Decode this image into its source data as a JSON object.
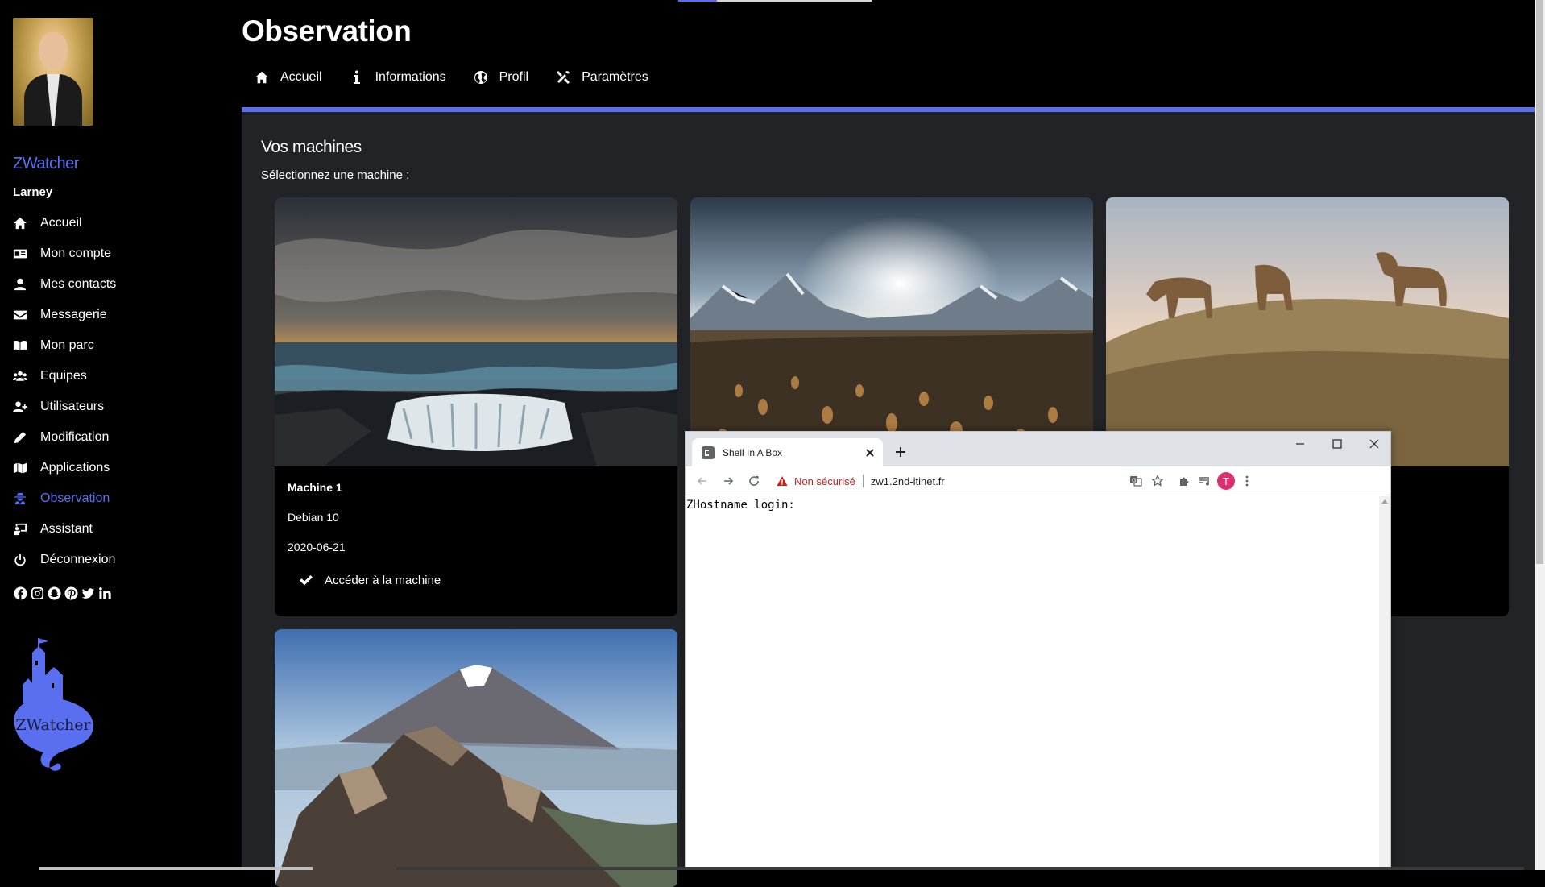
{
  "sidebar": {
    "brand": "ZWatcher",
    "username": "Larney",
    "items": [
      {
        "label": "Accueil",
        "icon": "home-icon"
      },
      {
        "label": "Mon compte",
        "icon": "id-card-icon"
      },
      {
        "label": "Mes contacts",
        "icon": "user-icon"
      },
      {
        "label": "Messagerie",
        "icon": "envelope-icon"
      },
      {
        "label": "Mon parc",
        "icon": "book-icon"
      },
      {
        "label": "Equipes",
        "icon": "users-icon"
      },
      {
        "label": "Utilisateurs",
        "icon": "user-plus-icon"
      },
      {
        "label": "Modification",
        "icon": "pencil-icon"
      },
      {
        "label": "Applications",
        "icon": "map-icon"
      },
      {
        "label": "Observation",
        "icon": "user-secret-icon",
        "active": true
      },
      {
        "label": "Assistant",
        "icon": "chalkboard-icon"
      },
      {
        "label": "Déconnexion",
        "icon": "power-icon"
      }
    ],
    "social": [
      "facebook-icon",
      "instagram-icon",
      "snapchat-icon",
      "pinterest-icon",
      "twitter-icon",
      "linkedin-icon"
    ],
    "logo_text": "ZWatcher"
  },
  "header": {
    "title": "Observation",
    "nav": [
      {
        "label": "Accueil",
        "icon": "home-icon"
      },
      {
        "label": "Informations",
        "icon": "info-icon"
      },
      {
        "label": "Profil",
        "icon": "globe-icon"
      },
      {
        "label": "Paramètres",
        "icon": "tools-icon"
      }
    ]
  },
  "main": {
    "heading": "Vos machines",
    "subheading": "Sélectionnez une machine :",
    "cards": [
      {
        "title": "Machine 1",
        "os": "Debian 10",
        "date": "2020-06-21",
        "action": "Accéder à la machine"
      }
    ]
  },
  "browser": {
    "tab_title": "Shell In A Box",
    "security": "Non sécurisé",
    "url": "zw1.2nd-itinet.fr",
    "profile_initial": "T",
    "terminal_text": "ZHostname login:"
  },
  "colors": {
    "accent": "#5a6ff0",
    "panel": "#222326",
    "background": "#000000"
  }
}
